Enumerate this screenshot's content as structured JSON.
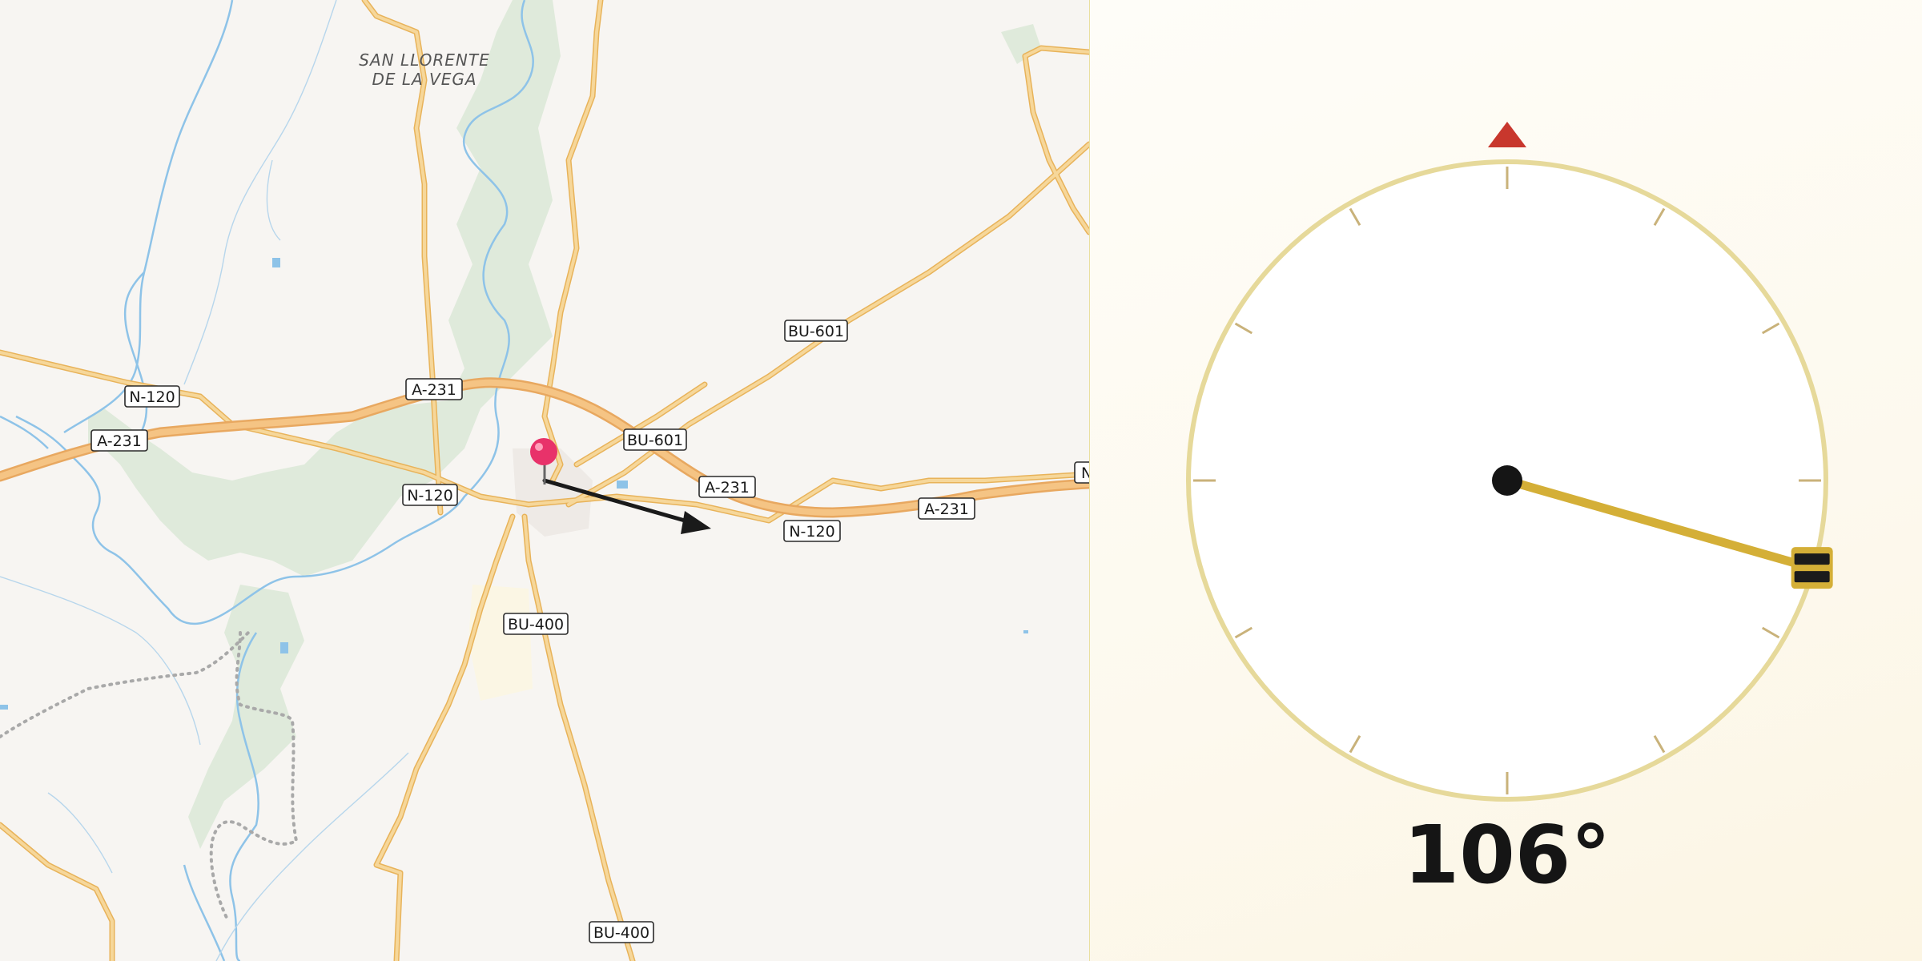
{
  "map": {
    "place_labels": [
      "SAN LLORENTE",
      "DE LA VEGA"
    ],
    "road_labels": {
      "n120_w": "N-120",
      "a231_w": "A-231",
      "a231_c": "A-231",
      "n120_c": "N-120",
      "bu601_n": "BU-601",
      "bu601_c": "BU-601",
      "a231_e1": "A-231",
      "n120_e": "N-120",
      "a231_e2": "A-231",
      "edge_e": "N",
      "bu400_c": "BU-400",
      "bu400_s": "BU-400"
    },
    "marker_icon": "map-pin-icon",
    "direction_icon": "direction-arrow-icon",
    "colors": {
      "background": "#f7f5f2",
      "road": "#f6c978",
      "road_edge": "#e8b35a",
      "water": "#8ec3e8",
      "park": "#dfeadb",
      "pin": "#e8326a",
      "arrow": "#1a1a1a"
    }
  },
  "compass": {
    "heading_value": 106,
    "heading_text": "106°",
    "north_marker_icon": "north-triangle-icon",
    "needle_icon": "compass-needle-icon",
    "colors": {
      "ring": "#e6d99a",
      "ticks": "#c9b27a",
      "north": "#c8372d",
      "needle": "#d4af37",
      "hub": "#151515"
    }
  }
}
